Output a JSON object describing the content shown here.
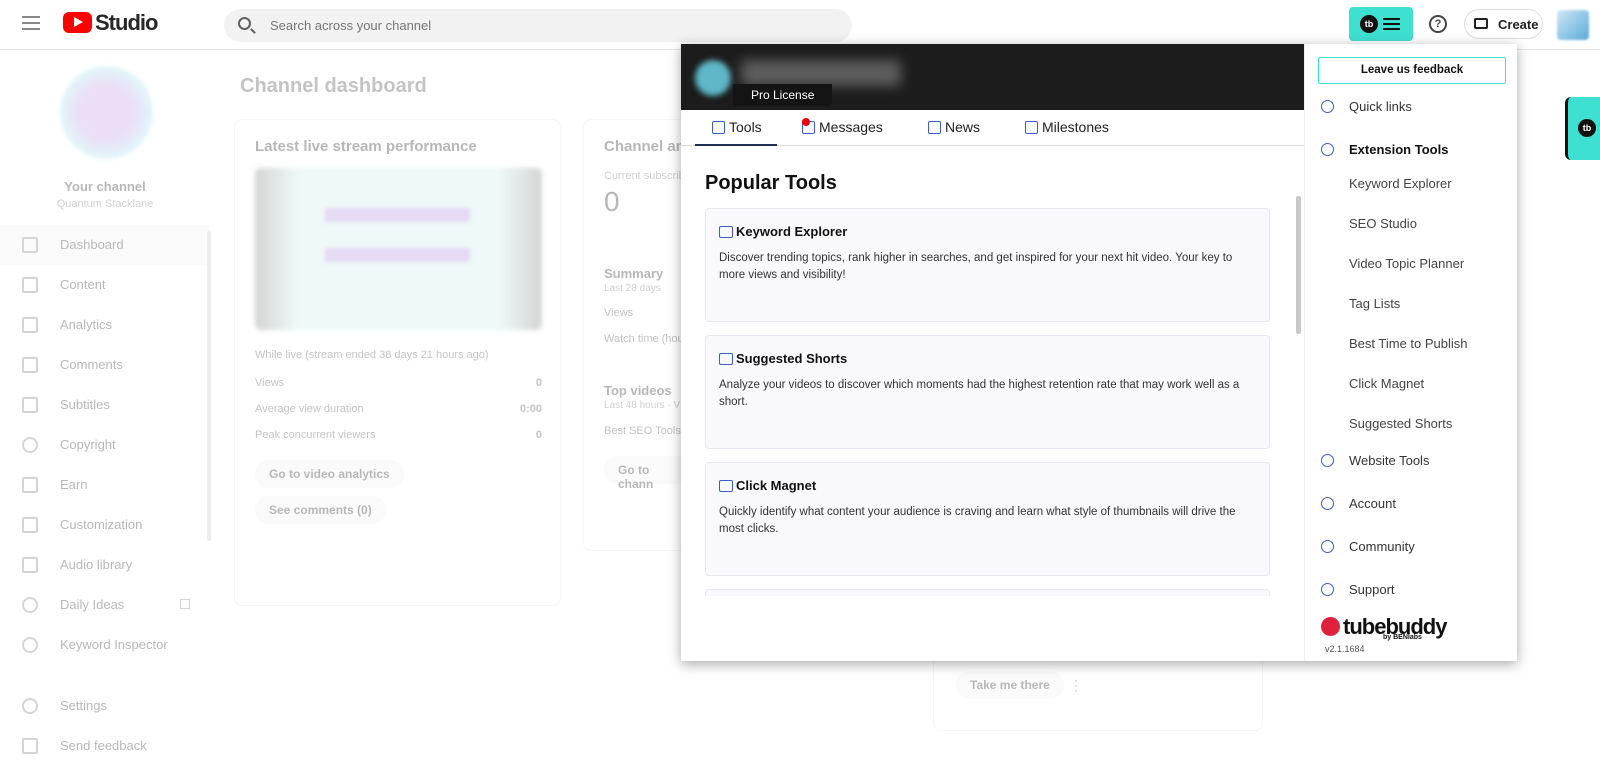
{
  "topbar": {
    "brand": "Studio",
    "search_placeholder": "Search across your channel",
    "help_glyph": "?",
    "create_label": "Create",
    "tb_glyph": "tb"
  },
  "sidebar": {
    "channel_title": "Your channel",
    "channel_name": "Quantum Stacklane",
    "items": [
      {
        "label": "Dashboard",
        "icon": "dashboard-icon"
      },
      {
        "label": "Content",
        "icon": "content-icon"
      },
      {
        "label": "Analytics",
        "icon": "analytics-icon"
      },
      {
        "label": "Comments",
        "icon": "comments-icon"
      },
      {
        "label": "Subtitles",
        "icon": "subtitles-icon"
      },
      {
        "label": "Copyright",
        "icon": "copyright-icon"
      },
      {
        "label": "Earn",
        "icon": "earn-icon"
      },
      {
        "label": "Customization",
        "icon": "customization-icon"
      },
      {
        "label": "Audio library",
        "icon": "audio-library-icon"
      },
      {
        "label": "Daily Ideas",
        "icon": "daily-ideas-icon"
      },
      {
        "label": "Keyword Inspector",
        "icon": "keyword-inspector-icon"
      }
    ],
    "settings_label": "Settings",
    "feedback_label": "Send feedback"
  },
  "dashboard": {
    "title": "Channel dashboard",
    "live_card": {
      "title": "Latest live stream performance",
      "status": "While live (stream ended 38 days 21 hours ago)",
      "stats": [
        {
          "label": "Views",
          "value": "0"
        },
        {
          "label": "Average view duration",
          "value": "0:00"
        },
        {
          "label": "Peak concurrent viewers",
          "value": "0"
        }
      ],
      "btn_analytics": "Go to video analytics",
      "btn_comments": "See comments (0)"
    },
    "analytics_card": {
      "title": "Channel an",
      "subs_label": "Current subscrib",
      "subs_value": "0",
      "summary": "Summary",
      "summary_sub": "Last 28 days",
      "views": "Views",
      "watch": "Watch time (hou",
      "top_videos": "Top videos",
      "top_sub": "Last 48 hours · V",
      "best_seo": "Best SEO Tools",
      "btn": "Go to chann"
    },
    "lower_card": {
      "btn": "Take me there",
      "menu_glyph": "⋮"
    }
  },
  "popup": {
    "license": "Pro License",
    "tabs": [
      {
        "label": "Tools",
        "active": true
      },
      {
        "label": "Messages",
        "active": false
      },
      {
        "label": "News",
        "active": false
      },
      {
        "label": "Milestones",
        "active": false
      }
    ],
    "heading": "Popular Tools",
    "tools": [
      {
        "title": "Keyword Explorer",
        "desc": "Discover trending topics, rank higher in searches, and get inspired for your next hit video. Your key to more views and visibility!"
      },
      {
        "title": "Suggested Shorts",
        "desc": "Analyze your videos to discover which moments had the highest retention rate that may work well as a short."
      },
      {
        "title": "Click Magnet",
        "desc": "Quickly identify what content your audience is craving and learn what style of thumbnails will drive the most clicks."
      }
    ],
    "menu": {
      "feedback": "Leave us feedback",
      "quick_links": "Quick links",
      "extension_tools": "Extension Tools",
      "tools": [
        "Keyword Explorer",
        "SEO Studio",
        "Video Topic Planner",
        "Tag Lists",
        "Best Time to Publish",
        "Click Magnet",
        "Suggested Shorts"
      ],
      "website_tools": "Website Tools",
      "account": "Account",
      "community": "Community",
      "support": "Support",
      "logo": "tubebuddy",
      "logo_by": "by BENlabs",
      "version": "v2.1.1684"
    }
  },
  "colors": {
    "accent": "#3ee0d2",
    "header": "#1c1c1c",
    "icon_blue": "#3b5ccc",
    "yt_red": "#ff0000",
    "tb_red": "#e0203c"
  }
}
